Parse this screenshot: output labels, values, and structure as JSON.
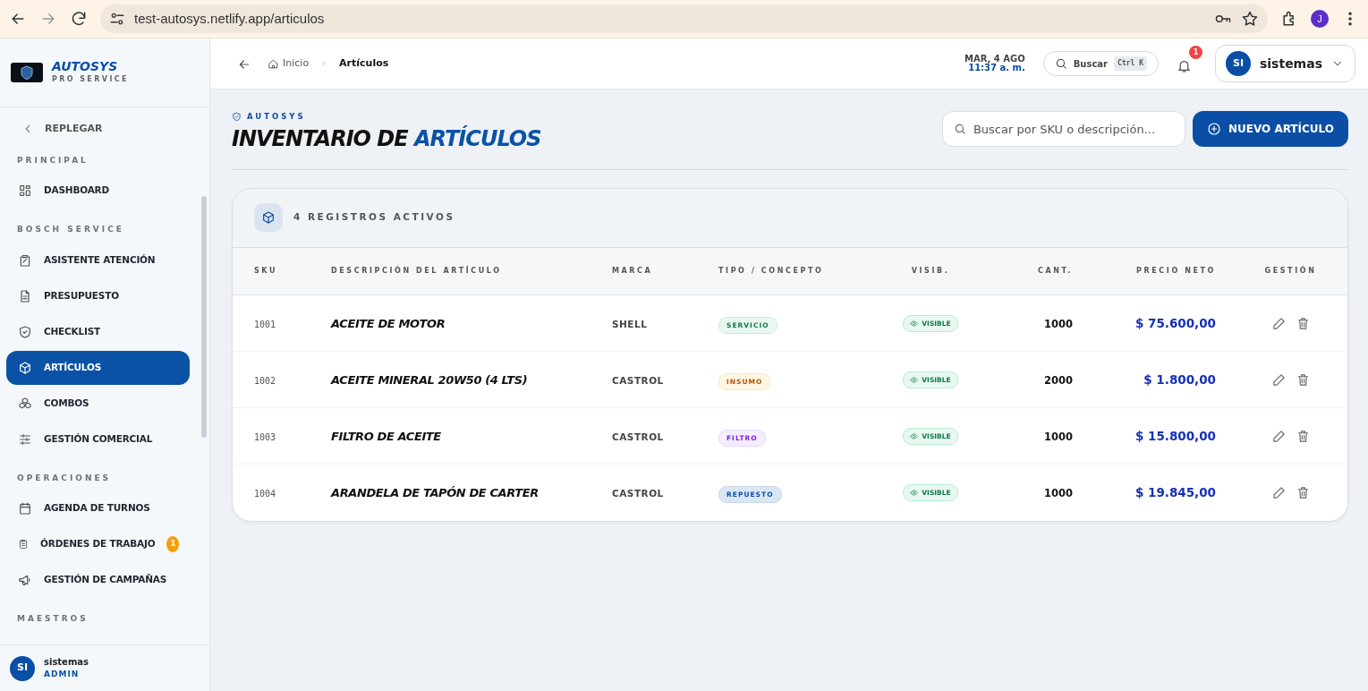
{
  "browser": {
    "url": "test-autosys.netlify.app/articulos",
    "profile_initial": "J"
  },
  "sidebar": {
    "brand": "AUTOSYS",
    "tagline": "PRO SERVICE",
    "collapse": "REPLEGAR",
    "sections": [
      {
        "title": "PRINCIPAL",
        "items": [
          {
            "label": "DASHBOARD",
            "selected": false
          }
        ]
      },
      {
        "title": "BOSCH SERVICE",
        "items": [
          {
            "label": "ASISTENTE ATENCIÓN",
            "selected": false
          },
          {
            "label": "PRESUPUESTO",
            "selected": false
          },
          {
            "label": "CHECKLIST",
            "selected": false
          },
          {
            "label": "ARTÍCULOS",
            "selected": true
          },
          {
            "label": "COMBOS",
            "selected": false
          },
          {
            "label": "GESTIÓN COMERCIAL",
            "selected": false
          }
        ]
      },
      {
        "title": "OPERACIONES",
        "items": [
          {
            "label": "AGENDA DE TURNOS",
            "selected": false
          },
          {
            "label": "ÓRDENES DE TRABAJO",
            "selected": false,
            "badge": "1"
          },
          {
            "label": "GESTIÓN DE CAMPAÑAS",
            "selected": false
          }
        ]
      },
      {
        "title": "MAESTROS"
      }
    ],
    "user": {
      "initials": "SI",
      "name": "sistemas",
      "role": "ADMIN"
    }
  },
  "topbar": {
    "breadcrumb": [
      "Inicio",
      "Artículos"
    ],
    "date": "MAR, 4 AGO",
    "time": "11:37 a. m.",
    "search": "Buscar",
    "shortcut": "Ctrl K",
    "notifications": "1",
    "user": {
      "initials": "SI",
      "name": "sistemas"
    }
  },
  "page": {
    "eyebrow": "AUTOSYS",
    "title": "INVENTARIO DE",
    "title_accent": "ARTÍCULOS",
    "search": {
      "placeholder": "Buscar por SKU o descripción..."
    },
    "new_button": "NUEVO ARTÍCULO"
  },
  "table": {
    "summary": "4 REGISTROS ACTIVOS",
    "columns": [
      "SKU",
      "DESCRIPCIÓN DEL ARTÍCULO",
      "MARCA",
      "TIPO / CONCEPTO",
      "VISIB.",
      "CANT.",
      "PRECIO NETO",
      "GESTIÓN"
    ],
    "rows": [
      {
        "sku": "1001",
        "description": "ACEITE DE MOTOR",
        "brand": "SHELL",
        "type": {
          "label": "SERVICIO",
          "kind": "servicio"
        },
        "visibility": {
          "label": "VISIBLE",
          "visible": true
        },
        "quantity": "1000",
        "price": "$ 75.600,00"
      },
      {
        "sku": "1002",
        "description": "ACEITE MINERAL 20W50 (4 LTS)",
        "brand": "CASTROL",
        "type": {
          "label": "INSUMO",
          "kind": "insumo"
        },
        "visibility": {
          "label": "VISIBLE",
          "visible": true
        },
        "quantity": "2000",
        "price": "$ 1.800,00"
      },
      {
        "sku": "1003",
        "description": "FILTRO DE ACEITE",
        "brand": "CASTROL",
        "type": {
          "label": "FILTRO",
          "kind": "filtro"
        },
        "visibility": {
          "label": "VISIBLE",
          "visible": true
        },
        "quantity": "1000",
        "price": "$ 15.800,00"
      },
      {
        "sku": "1004",
        "description": "ARANDELA DE TAPÓN DE CARTER",
        "brand": "CASTROL",
        "type": {
          "label": "REPUESTO",
          "kind": "repuesto"
        },
        "visibility": {
          "label": "VISIBLE",
          "visible": true
        },
        "quantity": "1000",
        "price": "$ 19.845,00"
      }
    ]
  }
}
